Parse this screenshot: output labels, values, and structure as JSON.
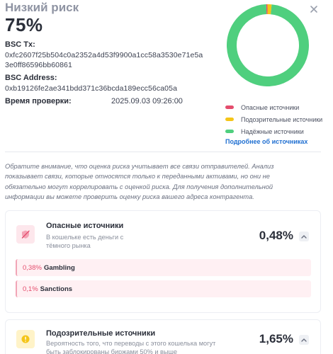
{
  "header": {
    "risk_level": "Низкий риск",
    "risk_score": "75%"
  },
  "details": {
    "tx_label": "BSC Tx:",
    "tx_line1": "0xfc2607f25b504c0a2352a4d53f9900a1cc58a3530e71e5a",
    "tx_line2": "3e0ff86596bb60861",
    "address_label": "BSC Address:",
    "address_value": "0xb19126fe2ae341bdd371c36bcda189ecc56ca05a",
    "check_time_label": "Время проверки:",
    "check_time_value": "2025.09.03 09:26:00"
  },
  "donut": {
    "segments": [
      {
        "name": "Опасные источники",
        "fraction": 0.0048,
        "color": "#e44d6d"
      },
      {
        "name": "Подозрительные источники",
        "fraction": 0.0165,
        "color": "#f5c518"
      },
      {
        "name": "Надёжные источники",
        "fraction": 0.9787,
        "color": "#4fcf7e"
      }
    ]
  },
  "legend": {
    "items": [
      {
        "label": "Опасные источники",
        "color": "#e44d6d"
      },
      {
        "label": "Подозрительные источники",
        "color": "#f5c518"
      },
      {
        "label": "Надёжные источники",
        "color": "#4fcf7e"
      }
    ],
    "more_link": "Подробнее об источниках"
  },
  "notice": "Обратите внимание, что оценка риска учитывает все связи отправителей. Анализ показывает связи, которые относятся только к переданными активами, но они не обязательно могут коррелировать с оценкой риска. Для получения дополнительной информации вы можете проверить оценку риска вашего адреса контрагента.",
  "dangerous": {
    "title": "Опасные источники",
    "description": "В кошельке есть деньги с тёмного рынка",
    "percent": "0,48%",
    "icon": "blocked-shield-icon",
    "sources": [
      {
        "percent": "0,38%",
        "name": "Gambling"
      },
      {
        "percent": "0,1%",
        "name": "Sanctions"
      }
    ]
  },
  "suspicious": {
    "title": "Подозрительные источники",
    "description": "Вероятность того, что переводы с этого кошелька могут быть заблокированы биржами 50% и выше",
    "percent": "1,65%",
    "icon": "warning-icon"
  }
}
